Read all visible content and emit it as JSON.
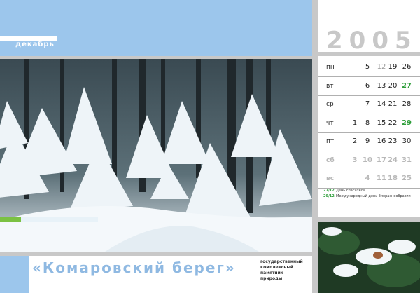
{
  "header": {
    "month": "декабрь",
    "year": "2005"
  },
  "calendar": {
    "rows": [
      {
        "day": "пн",
        "nums": [
          "5",
          "12",
          "19",
          "26"
        ],
        "weekend": false,
        "styles": [
          "",
          "grey",
          "",
          ""
        ]
      },
      {
        "day": "вт",
        "nums": [
          "6",
          "13",
          "20",
          "27"
        ],
        "weekend": false,
        "styles": [
          "",
          "",
          "",
          "green"
        ]
      },
      {
        "day": "ср",
        "nums": [
          "7",
          "14",
          "21",
          "28"
        ],
        "weekend": false,
        "styles": [
          "",
          "",
          "",
          ""
        ]
      },
      {
        "day": "чт",
        "nums": [
          "1",
          "8",
          "15",
          "22",
          "29"
        ],
        "weekend": false,
        "styles": [
          "",
          "",
          "",
          "",
          "green"
        ]
      },
      {
        "day": "пт",
        "nums": [
          "2",
          "9",
          "16",
          "23",
          "30"
        ],
        "weekend": false,
        "styles": [
          "",
          "",
          "",
          "",
          ""
        ]
      },
      {
        "day": "сб",
        "nums": [
          "3",
          "10",
          "17",
          "24",
          "31"
        ],
        "weekend": true,
        "styles": [
          "",
          "",
          "",
          "",
          ""
        ]
      },
      {
        "day": "вс",
        "nums": [
          "4",
          "11",
          "18",
          "25"
        ],
        "weekend": true,
        "styles": [
          "",
          "",
          "",
          ""
        ]
      }
    ],
    "holidays": [
      {
        "date": "27/12",
        "name": "День спасателя"
      },
      {
        "date": "29/12",
        "name": "Международный день биоразнообразия"
      }
    ]
  },
  "footer": {
    "title": "«Комаровский берег»",
    "subtitle": [
      "государственный",
      "комплексный",
      "памятник",
      "природы"
    ]
  },
  "colors": {
    "accent": "#9cc6ec",
    "green": "#2e9e3a",
    "grey": "#c8c8c8"
  }
}
